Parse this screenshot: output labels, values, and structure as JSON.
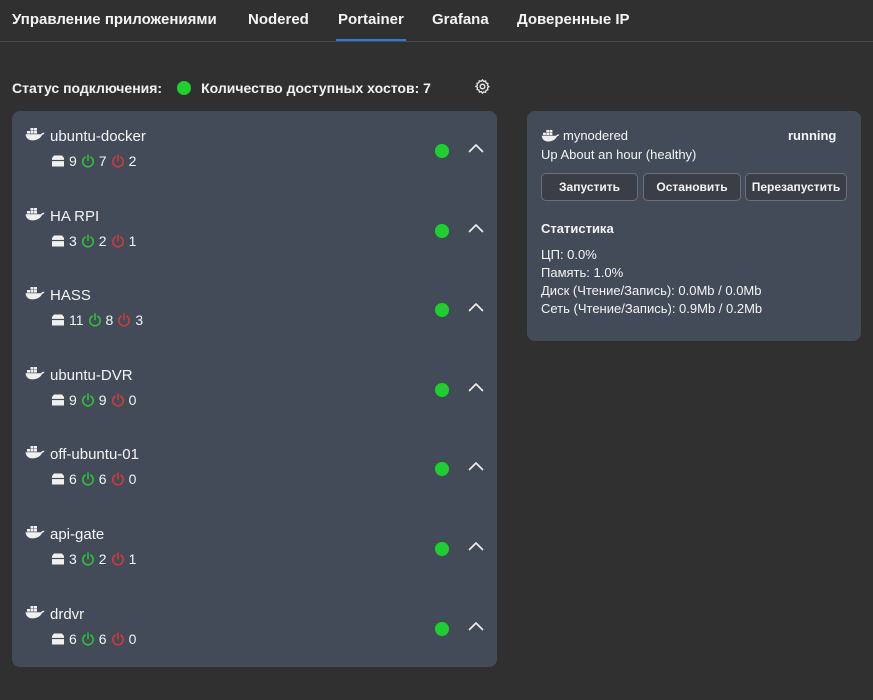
{
  "nav": {
    "tabs": [
      {
        "label": "Управление приложениями"
      },
      {
        "label": "Nodered"
      },
      {
        "label": "Portainer"
      },
      {
        "label": "Grafana"
      },
      {
        "label": "Доверенные IP"
      }
    ],
    "active_tab": "Portainer"
  },
  "status": {
    "label": "Статус подключения:",
    "hosts_label": "Количество доступных хостов: 7",
    "settings_icon": "gear-icon"
  },
  "colors": {
    "online": "#1fcf2f",
    "running": "#2fbf3a",
    "stopped": "#d23a3a",
    "accent": "#2b7cd3"
  },
  "hosts": [
    {
      "name": "ubuntu-docker",
      "total": "9",
      "running": "7",
      "stopped": "2"
    },
    {
      "name": "HA RPI",
      "total": "3",
      "running": "2",
      "stopped": "1"
    },
    {
      "name": "HASS",
      "total": "11",
      "running": "8",
      "stopped": "3"
    },
    {
      "name": "ubuntu-DVR",
      "total": "9",
      "running": "9",
      "stopped": "0"
    },
    {
      "name": "off-ubuntu-01",
      "total": "6",
      "running": "6",
      "stopped": "0"
    },
    {
      "name": "api-gate",
      "total": "3",
      "running": "2",
      "stopped": "1"
    },
    {
      "name": "drdvr",
      "total": "6",
      "running": "6",
      "stopped": "0"
    }
  ],
  "container": {
    "name": "mynodered",
    "state": "running",
    "uptime": "Up About an hour (healthy)",
    "buttons": {
      "start": "Запустить",
      "stop": "Остановить",
      "restart": "Перезапустить"
    },
    "stats_title": "Статистика",
    "stats": {
      "cpu": "ЦП: 0.0%",
      "memory": "Память: 1.0%",
      "disk": "Диск (Чтение/Запись): 0.0Mb / 0.0Mb",
      "network": "Сеть (Чтение/Запись): 0.9Mb / 0.2Mb"
    }
  }
}
